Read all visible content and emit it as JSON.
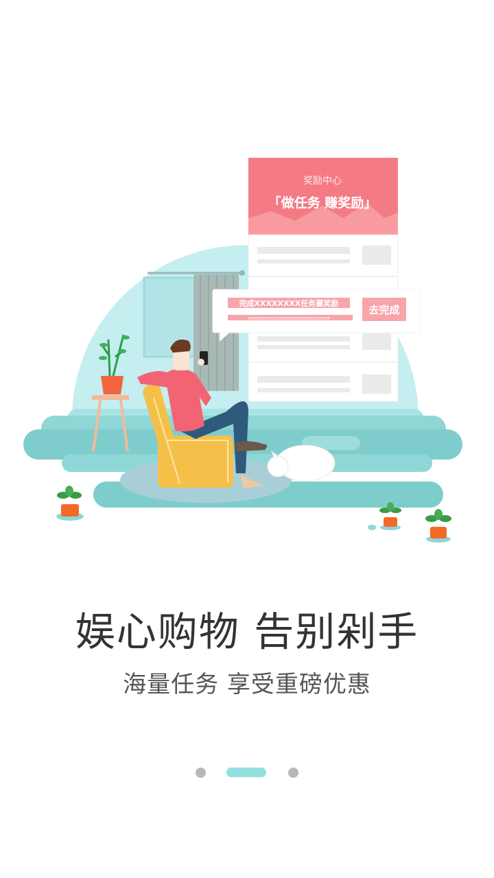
{
  "illustration": {
    "card_subtitle": "奖励中心",
    "card_title": "「做任务  赚奖励」",
    "task_text": "完成XXXXXXXX任务赢奖励",
    "task_subtext": "xxxxxxxxxxxxxxxxxxxxxxxxxxxxx",
    "task_button": "去完成"
  },
  "headline": "娱心购物 告别剁手",
  "subline": "海量任务 享受重磅优惠",
  "pager": {
    "total": 3,
    "active_index": 1
  },
  "colors": {
    "accent": "#93dfe0",
    "card_red": "#f47b84",
    "chair": "#f5c04a"
  }
}
